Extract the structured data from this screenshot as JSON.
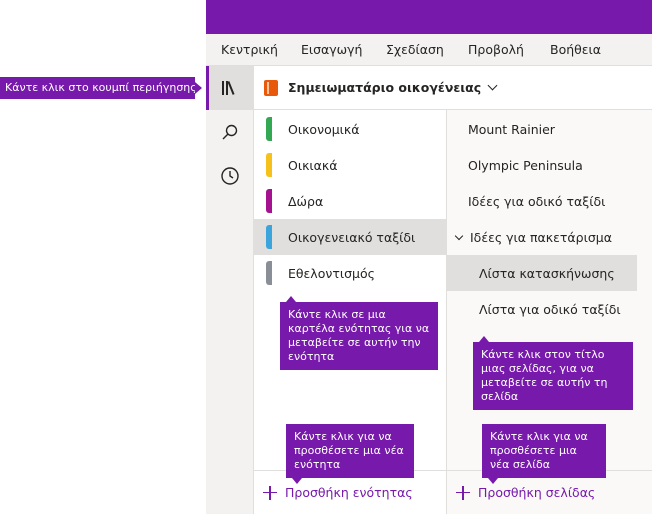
{
  "menu": {
    "items": [
      "Κεντρική",
      "Εισαγωγή",
      "Σχεδίαση",
      "Προβολή",
      "Βοήθεια"
    ]
  },
  "nav_rail": {
    "icons": [
      "notebooks-icon",
      "search-icon",
      "recent-clock-icon"
    ]
  },
  "notebook": {
    "title": "Σημειωματάριο οικογένειας"
  },
  "sections": [
    {
      "label": "Οικονομικά",
      "color": "#33a852"
    },
    {
      "label": "Οικιακά",
      "color": "#f7c11c"
    },
    {
      "label": "Δώρα",
      "color": "#a4128f"
    },
    {
      "label": "Οικογενειακό ταξίδι",
      "color": "#3ca4dc",
      "selected": true
    },
    {
      "label": "Εθελοντισμός",
      "color": "#8a8f97"
    }
  ],
  "pages": [
    {
      "label": "Mount Rainier"
    },
    {
      "label": "Olympic Peninsula"
    },
    {
      "label": "Ιδέες για οδικό ταξίδι"
    },
    {
      "label": "Ιδέες για πακετάρισμα",
      "expanded": true
    },
    {
      "label": "Λίστα κατασκήνωσης",
      "selected": true,
      "subpage": true
    },
    {
      "label": "Λίστα για οδικό ταξίδι",
      "subpage": true
    }
  ],
  "add": {
    "section_label": "Προσθήκη ενότητας",
    "page_label": "Προσθήκη σελίδας"
  },
  "callouts": {
    "nav": "Κάντε κλικ στο κουμπί περιήγησης",
    "section_tab": "Κάντε κλικ σε μια καρτέλα ενότητας για να μεταβείτε σε αυτήν την ενότητα",
    "page_title": "Κάντε κλικ στον τίτλο μιας σελίδας, για να μεταβείτε σε αυτήν τη σελίδα",
    "add_section": "Κάντε κλικ για να προσθέσετε μια νέα ενότητα",
    "add_page": "Κάντε κλικ για να προσθέσετε μια νέα σελίδα"
  },
  "colors": {
    "accent": "#7719aa",
    "notebook_icon": "#e8590c"
  }
}
